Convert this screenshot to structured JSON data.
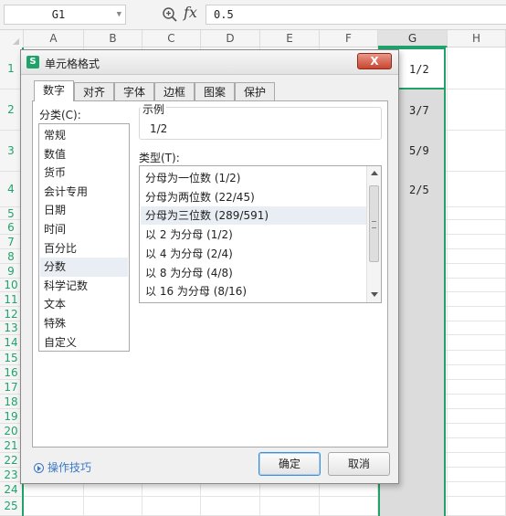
{
  "formula_bar": {
    "name_box": "G1",
    "formula": "0.5",
    "fx_label": "fx"
  },
  "columns": [
    "A",
    "B",
    "C",
    "D",
    "E",
    "F",
    "G",
    "H"
  ],
  "rows": [
    "1",
    "2",
    "3",
    "4",
    "5",
    "6",
    "7",
    "8",
    "9",
    "10",
    "11",
    "12",
    "13",
    "14",
    "15",
    "16",
    "17",
    "18",
    "19",
    "20",
    "21",
    "22",
    "23",
    "24",
    "25"
  ],
  "cells": {
    "G1": "1/2",
    "G2": "3/7",
    "G3": "5/9",
    "G4": "2/5"
  },
  "dialog": {
    "title": "单元格格式",
    "logo": "S",
    "close_label": "X",
    "tabs": [
      "数字",
      "对齐",
      "字体",
      "边框",
      "图案",
      "保护"
    ],
    "active_tab": "数字",
    "category_label": "分类(C):",
    "categories": [
      "常规",
      "数值",
      "货币",
      "会计专用",
      "日期",
      "时间",
      "百分比",
      "分数",
      "科学记数",
      "文本",
      "特殊",
      "自定义"
    ],
    "selected_category": "分数",
    "sample_label": "示例",
    "sample_value": "1/2",
    "type_label": "类型(T):",
    "types": [
      "分母为一位数 (1/2)",
      "分母为两位数 (22/45)",
      "分母为三位数 (289/591)",
      "以 2 为分母 (1/2)",
      "以 4 为分母 (2/4)",
      "以 8 为分母 (4/8)",
      "以 16 为分母 (8/16)"
    ],
    "selected_type": "分母为三位数 (289/591)",
    "tips_label": "操作技巧",
    "ok_label": "确定",
    "cancel_label": "取消"
  },
  "colors": {
    "accent_green": "#1fa36a",
    "link_blue": "#3a78c8",
    "close_red": "#c9452f"
  }
}
